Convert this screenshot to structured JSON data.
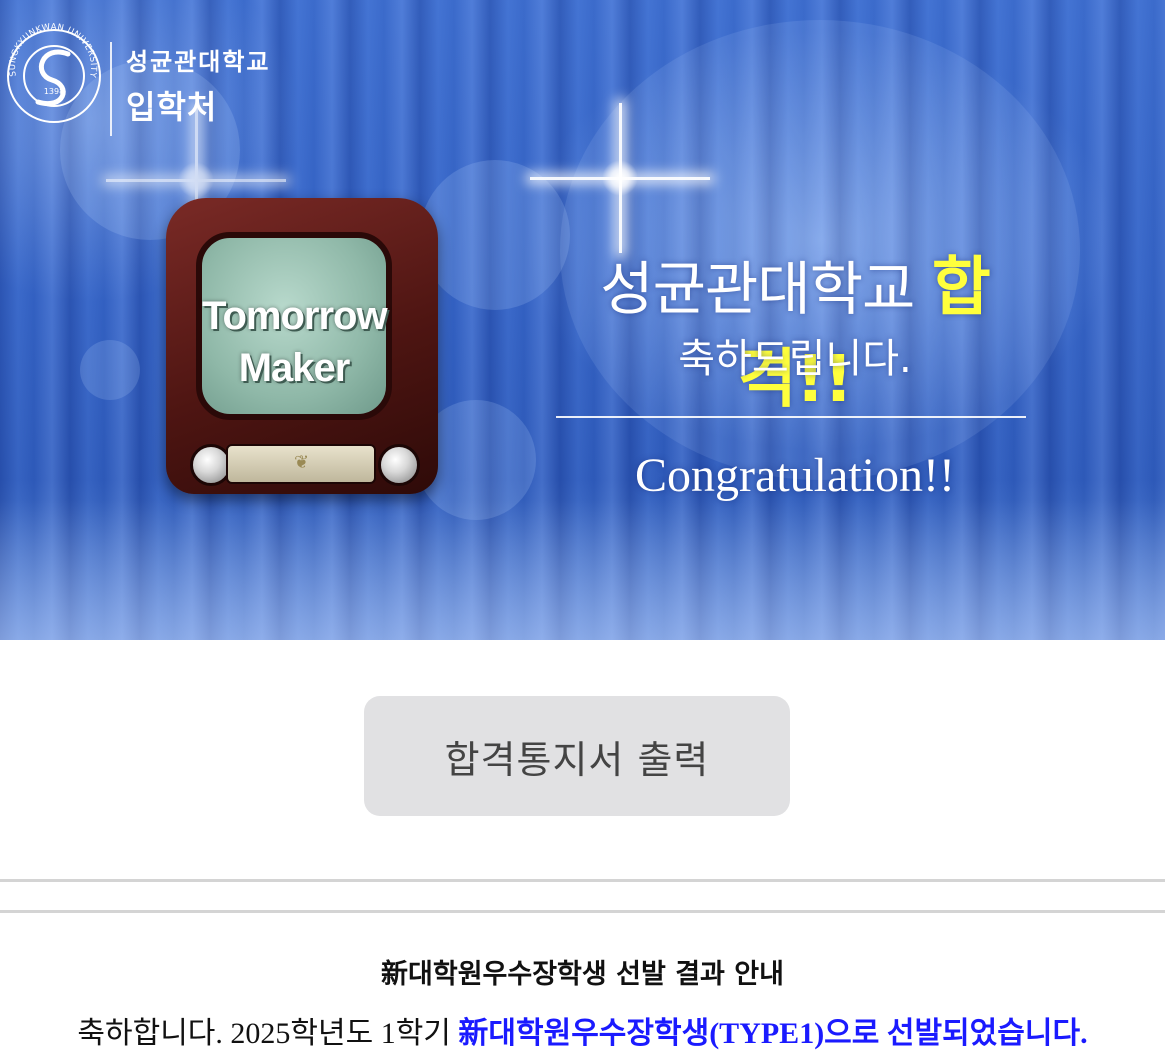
{
  "banner": {
    "logo": {
      "seal_text": "SUNGKYUNKWAN UNIVERSITY",
      "seal_year": "1398",
      "university": "성균관대학교",
      "office": "입학처"
    },
    "tv_text_line1": "Tomorrow",
    "tv_text_line2": "Maker",
    "headline_prefix": "성균관대학교 ",
    "headline_emphasis": "합격!!",
    "subline": "축하드립니다.",
    "congrats": "Congratulation!!",
    "colors": {
      "emphasis": "#ffff3c",
      "background": "#3564c6"
    }
  },
  "print_button_label": "합격통지서 출력",
  "notice": {
    "title": "新대학원우수장학생 선발 결과 안내",
    "line_plain": "축하합니다. 2025학년도 1학기 ",
    "line_emphasis": "新대학원우수장학생(TYPE1)으로 선발되었습니다.",
    "emphasis_color": "#1a1aff"
  }
}
